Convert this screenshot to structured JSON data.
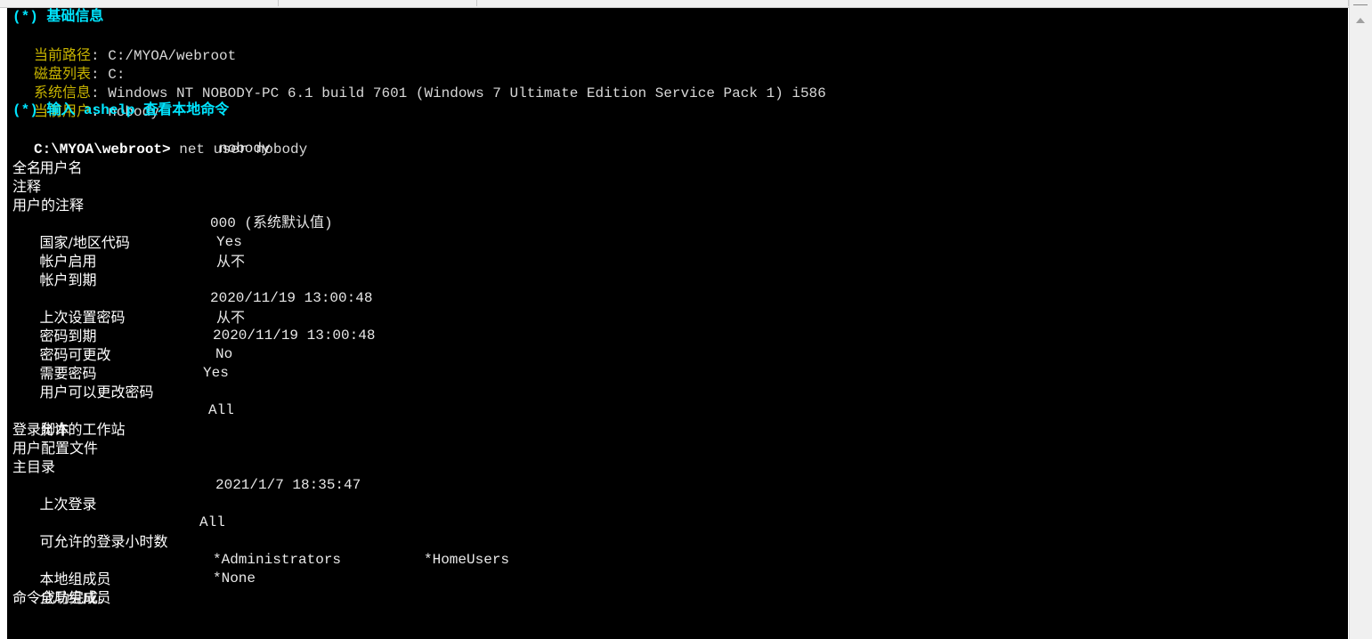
{
  "header": {
    "basic_info": "(*) 基础信息",
    "path_label": "当前路径",
    "path_value": "C:/MYOA/webroot",
    "disk_label": "磁盘列表",
    "disk_value": "C:",
    "sysinfo_label": "系统信息",
    "sysinfo_value": "Windows NT NOBODY-PC 6.1 build 7601 (Windows 7 Ultimate Edition Service Pack 1) i586",
    "user_label": "当前用户",
    "user_value": "nobody",
    "hint": "(*) 输入 ashelp 查看本地命令",
    "separator": ": "
  },
  "prompt": {
    "path": "C:\\MYOA\\webroot>",
    "command": " net user nobody"
  },
  "output": {
    "username_label": "用户名",
    "username_value": "nobody",
    "fullname_label": "全名",
    "comment_label": "注释",
    "usercomment_label": "用户的注释",
    "country_label": "国家/地区代码",
    "country_value": "000 (系统默认值)",
    "active_label": "帐户启用",
    "active_value": "Yes",
    "expires_label": "帐户到期",
    "expires_value": "从不",
    "pwdlastset_label": "上次设置密码",
    "pwdlastset_value": "2020/11/19 13:00:48",
    "pwdexpires_label": "密码到期",
    "pwdexpires_value": "从不",
    "pwdchangeable_label": "密码可更改",
    "pwdchangeable_value": "2020/11/19 13:00:48",
    "pwdrequired_label": "需要密码",
    "pwdrequired_value": "No",
    "userchange_label": "用户可以更改密码",
    "userchange_value": "Yes",
    "workstations_label": "允许的工作站",
    "workstations_value": "All",
    "logonscript_label": "登录脚本",
    "profile_label": "用户配置文件",
    "homedir_label": "主目录",
    "lastlogon_label": "上次登录",
    "lastlogon_value": "2021/1/7 18:35:47",
    "logonhours_label": "可允许的登录小时数",
    "logonhours_value": "All",
    "localgroups_label": "本地组成员",
    "localgroups_value1": "*Administrators",
    "localgroups_value2": "*HomeUsers",
    "globalgroups_label": "全局组成员",
    "globalgroups_value": "*None",
    "done": "命令成功完成。"
  },
  "colors": {
    "background": "#000000",
    "heading": "#00e5ff",
    "label": "#c8b400",
    "text": "#d8d8d8"
  }
}
